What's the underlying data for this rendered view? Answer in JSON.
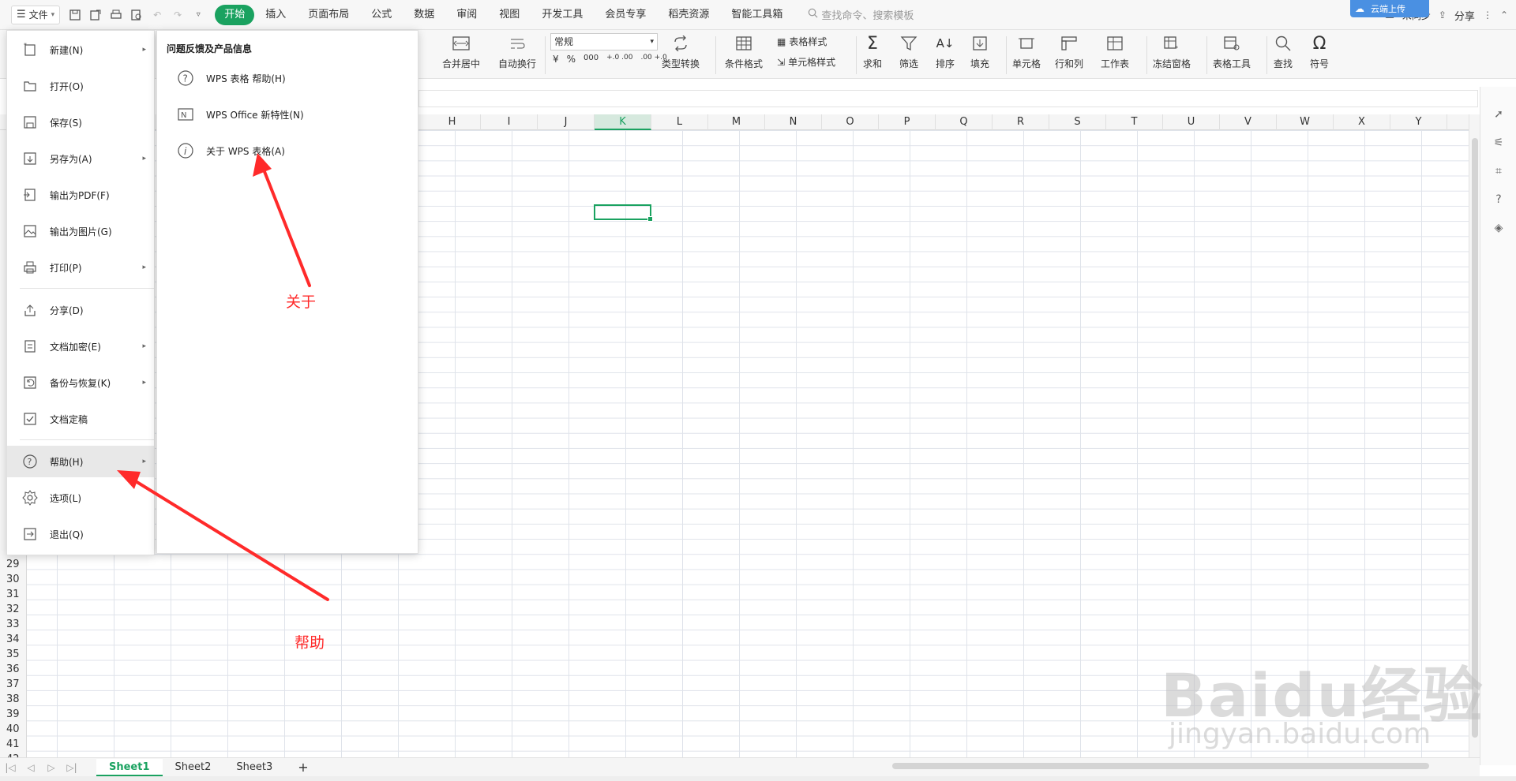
{
  "menubar": {
    "file_label": "文件",
    "tabs": [
      "开始",
      "插入",
      "页面布局",
      "公式",
      "数据",
      "审阅",
      "视图",
      "开发工具",
      "会员专享",
      "稻壳资源",
      "智能工具箱"
    ],
    "active_tab": "开始",
    "search_placeholder": "查找命令、搜索模板",
    "right_cloud": "未同步",
    "right_share": "分享",
    "cloud_badge": "云端上传"
  },
  "ribbon": {
    "merge": "合并居中",
    "wrap": "自动换行",
    "format_select": "常规",
    "currency": "¥",
    "percent": "%",
    "thousands": "000",
    "dec_inc": "+.0 .00",
    "dec_dec": ".00 +.0",
    "type_convert": "类型转换",
    "cond_format": "条件格式",
    "table_style": "表格样式",
    "cell_style": "单元格样式",
    "sum": "求和",
    "filter": "筛选",
    "sort": "排序",
    "fill": "填充",
    "cell": "单元格",
    "row_col": "行和列",
    "worksheet": "工作表",
    "freeze": "冻结窗格",
    "table_tools": "表格工具",
    "find": "查找",
    "symbol": "符号"
  },
  "grid": {
    "columns": [
      "H",
      "I",
      "J",
      "K",
      "L",
      "M",
      "N",
      "O",
      "P",
      "Q",
      "R",
      "S",
      "T",
      "U",
      "V",
      "W",
      "X",
      "Y"
    ],
    "selected_column": "K",
    "rows": [
      "29",
      "30",
      "31",
      "32",
      "33",
      "34",
      "35",
      "36",
      "37",
      "38",
      "39",
      "40",
      "41",
      "42"
    ]
  },
  "file_menu": {
    "items": [
      {
        "label": "新建(N)",
        "icon": "new-file-icon",
        "arrow": true
      },
      {
        "label": "打开(O)",
        "icon": "folder-open-icon",
        "arrow": false
      },
      {
        "label": "保存(S)",
        "icon": "save-icon",
        "arrow": false
      },
      {
        "label": "另存为(A)",
        "icon": "save-as-icon",
        "arrow": true
      },
      {
        "label": "输出为PDF(F)",
        "icon": "pdf-export-icon",
        "arrow": false
      },
      {
        "label": "输出为图片(G)",
        "icon": "image-export-icon",
        "arrow": false
      },
      {
        "label": "打印(P)",
        "icon": "printer-icon",
        "arrow": true
      },
      {
        "label": "分享(D)",
        "icon": "share-icon",
        "arrow": false
      },
      {
        "label": "文档加密(E)",
        "icon": "lock-icon",
        "arrow": true
      },
      {
        "label": "备份与恢复(K)",
        "icon": "backup-icon",
        "arrow": true
      },
      {
        "label": "文档定稿",
        "icon": "finalize-icon",
        "arrow": false
      },
      {
        "label": "帮助(H)",
        "icon": "help-icon",
        "arrow": true
      },
      {
        "label": "选项(L)",
        "icon": "gear-icon",
        "arrow": false
      },
      {
        "label": "退出(Q)",
        "icon": "exit-icon",
        "arrow": false
      }
    ]
  },
  "help_submenu": {
    "header": "问题反馈及产品信息",
    "items": [
      {
        "label": "WPS 表格 帮助(H)",
        "icon": "question-icon"
      },
      {
        "label": "WPS Office 新特性(N)",
        "icon": "new-features-icon"
      },
      {
        "label": "关于 WPS 表格(A)",
        "icon": "info-icon"
      }
    ]
  },
  "annotations": {
    "about": "关于",
    "help": "帮助"
  },
  "sheets": [
    "Sheet1",
    "Sheet2",
    "Sheet3"
  ],
  "active_sheet": "Sheet1",
  "watermark": {
    "main": "Baidu经验",
    "sub": "jingyan.baidu.com"
  },
  "colors": {
    "accent": "#1aa260",
    "annotation": "#ff2a2a"
  }
}
